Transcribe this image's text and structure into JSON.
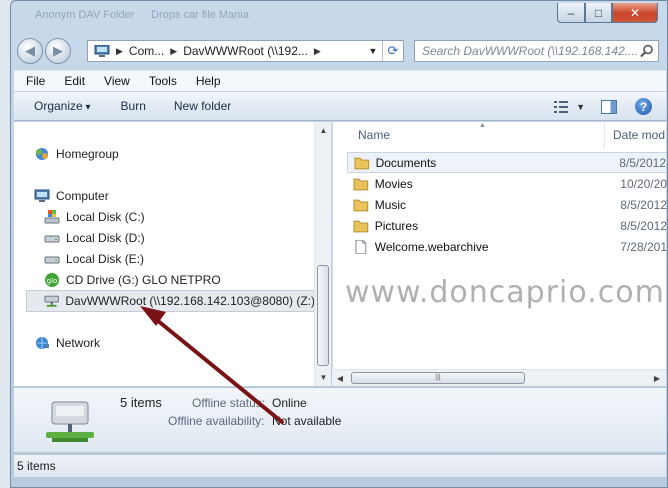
{
  "title_ghost": [
    "Anonym DAV Folder",
    "Drops car file Mania"
  ],
  "caption": {
    "minimize": "–",
    "maximize": "□",
    "close": "✕"
  },
  "address": {
    "segments": [
      "Com...",
      "DavWWWRoot (\\\\192...",
      ""
    ],
    "refresh_icon": "refresh-icon"
  },
  "search": {
    "placeholder": "Search DavWWWRoot (\\\\192.168.142...."
  },
  "menu": [
    "File",
    "Edit",
    "View",
    "Tools",
    "Help"
  ],
  "commands": {
    "organize": "Organize",
    "burn": "Burn",
    "new_folder": "New folder"
  },
  "nav": {
    "homegroup": "Homegroup",
    "computer": "Computer",
    "drives": [
      {
        "label": "Local Disk (C:)",
        "icon": "windows-drive-icon"
      },
      {
        "label": "Local Disk (D:)",
        "icon": "drive-icon"
      },
      {
        "label": "Local Disk (E:)",
        "icon": "drive-icon"
      },
      {
        "label": "CD Drive (G:) GLO NETPRO",
        "icon": "cd-drive-icon"
      },
      {
        "label": "DavWWWRoot (\\\\192.168.142.103@8080) (Z:)",
        "icon": "network-drive-icon"
      }
    ],
    "network": "Network"
  },
  "columns": {
    "name": "Name",
    "date": "Date mod"
  },
  "files": [
    {
      "name": "Documents",
      "date": "8/5/2012",
      "type": "folder"
    },
    {
      "name": "Movies",
      "date": "10/20/20",
      "type": "folder"
    },
    {
      "name": "Music",
      "date": "8/5/2012",
      "type": "folder"
    },
    {
      "name": "Pictures",
      "date": "8/5/2012",
      "type": "folder"
    },
    {
      "name": "Welcome.webarchive",
      "date": "7/28/201",
      "type": "file"
    }
  ],
  "watermark": "www.doncaprio.com",
  "details": {
    "count": "5 items",
    "offline_status_label": "Offline status:",
    "offline_status_value": "Online",
    "offline_avail_label": "Offline availability:",
    "offline_avail_value": "Not available"
  },
  "status": "5 items",
  "colors": {
    "arrow": "#7a1216",
    "folder": "#e8c25a"
  }
}
